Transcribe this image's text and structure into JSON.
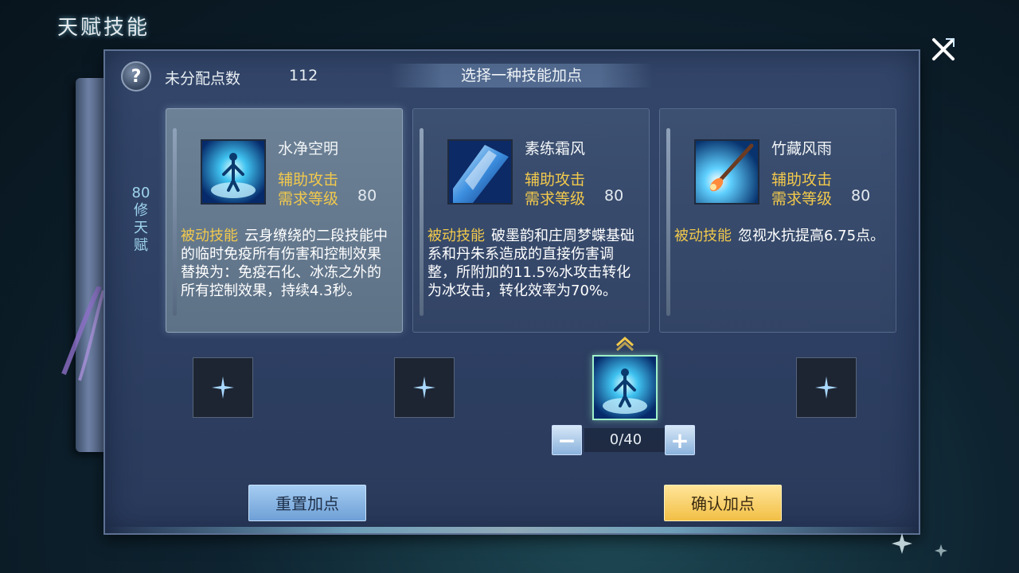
{
  "header": {
    "title": "天赋技能"
  },
  "panel": {
    "points_label": "未分配点数",
    "points_value": "112",
    "select_title": "选择一种技能加点",
    "side_tab": [
      "80",
      "修",
      "天",
      "赋"
    ]
  },
  "cards": [
    {
      "name": "水净空明",
      "type": "辅助攻击",
      "req_label": "需求等级",
      "req_value": "80",
      "tag": "被动技能",
      "desc": "云身缭绕的二段技能中的临时免疫所有伤害和控制效果替换为：免疫石化、冰冻之外的所有控制效果，持续4.3秒。",
      "icon": "figure-in-light-icon",
      "selected": true
    },
    {
      "name": "素练霜风",
      "type": "辅助攻击",
      "req_label": "需求等级",
      "req_value": "80",
      "tag": "被动技能",
      "desc": "破墨韵和庄周梦蝶基础系和丹朱系造成的直接伤害调整，所附加的11.5%水攻击转化为冰攻击，转化效率为70%。",
      "icon": "ice-crystal-icon",
      "selected": false
    },
    {
      "name": "竹藏风雨",
      "type": "辅助攻击",
      "req_label": "需求等级",
      "req_value": "80",
      "tag": "被动技能",
      "desc": "忽视水抗提高6.75点。",
      "icon": "brush-strike-icon",
      "selected": false
    }
  ],
  "stepper": {
    "value": "0/40",
    "minus": "−",
    "plus": "+"
  },
  "buttons": {
    "reset": "重置加点",
    "confirm": "确认加点"
  },
  "colors": {
    "accent_gold": "#f2c94c",
    "panel": "#2d3f62",
    "side_tab": "#9fd4ee"
  }
}
